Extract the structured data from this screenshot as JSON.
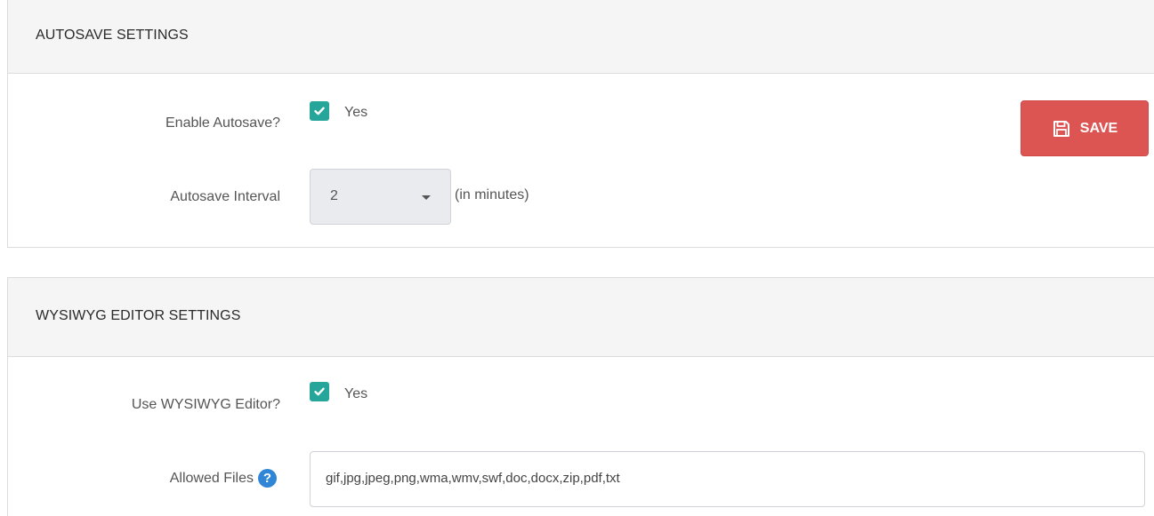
{
  "autosave": {
    "heading": "AUTOSAVE SETTINGS",
    "enable_label": "Enable Autosave?",
    "enable_checked": true,
    "enable_option": "Yes",
    "interval_label": "Autosave Interval",
    "interval_value": "2",
    "interval_suffix": "(in minutes)",
    "save_label": "SAVE"
  },
  "wysiwyg": {
    "heading": "WYSIWYG EDITOR SETTINGS",
    "use_label": "Use WYSIWYG Editor?",
    "use_checked": true,
    "use_option": "Yes",
    "allowed_label": "Allowed Files",
    "allowed_value": "gif,jpg,jpeg,png,wma,wmv,swf,doc,docx,zip,pdf,txt"
  },
  "icons": {
    "checkbox": "check-icon",
    "save": "floppy-disk-icon",
    "select": "caret-down-icon",
    "help": "question-circle-icon"
  },
  "colors": {
    "checkbox": "#26a69a",
    "save_button": "#dc5553",
    "help_icon": "#2f86d6",
    "select_bg": "#e9ebee",
    "heading_bg": "#f5f5f5"
  }
}
